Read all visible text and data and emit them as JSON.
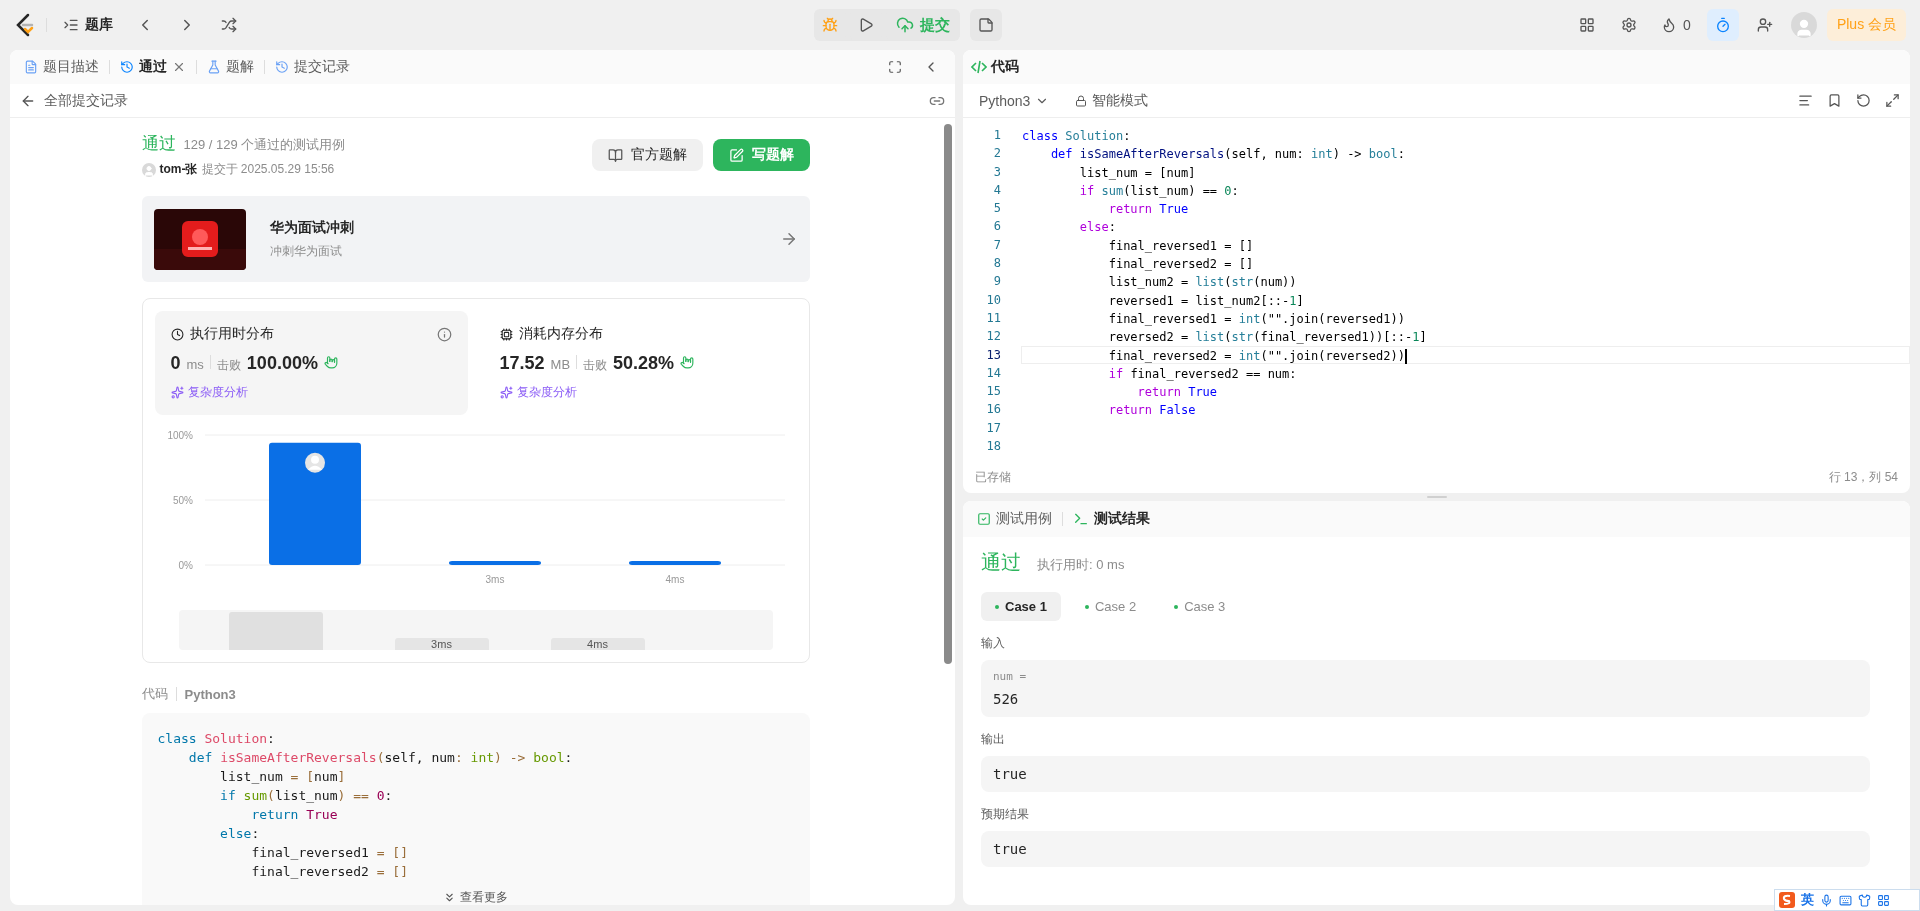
{
  "top_bar": {
    "problem_list": "题库",
    "submit": "提交",
    "streak": "0",
    "plus": "Plus 会员"
  },
  "left_panel": {
    "tabs": [
      {
        "label": "题目描述",
        "selected": false,
        "closable": false
      },
      {
        "label": "通过",
        "selected": true,
        "closable": true
      },
      {
        "label": "题解",
        "selected": false,
        "closable": false
      },
      {
        "label": "提交记录",
        "selected": false,
        "closable": false
      }
    ],
    "back_link": "全部提交记录",
    "result": {
      "status": "通过",
      "tests": "129 / 129 个通过的测试用例",
      "user": "tom-张",
      "submitted": "提交于 2025.05.29 15:56"
    },
    "buttons": [
      "官方题解",
      "写题解"
    ],
    "promo": {
      "title": "华为面试冲刺",
      "subtitle": "冲刺华为面试"
    },
    "stats": [
      {
        "title": "执行用时分布",
        "value": "0",
        "unit": "ms",
        "beats_label": "击败",
        "beats": "100.00%",
        "analysis": "复杂度分析",
        "selected": true
      },
      {
        "title": "消耗内存分布",
        "value": "17.52",
        "unit": "MB",
        "beats_label": "击败",
        "beats": "50.28%",
        "analysis": "复杂度分析",
        "selected": false
      }
    ],
    "chart_data": {
      "type": "bar",
      "categories": [
        null,
        "3ms",
        "4ms"
      ],
      "values": [
        94,
        3,
        3
      ],
      "ylim": [
        0,
        100
      ],
      "yticks": [
        {
          "value": 0,
          "label": "0%"
        },
        {
          "value": 50,
          "label": "50%"
        },
        {
          "value": 100,
          "label": "100%"
        }
      ]
    },
    "overview_labels": [
      "3ms",
      "4ms"
    ],
    "code": {
      "label": "代码",
      "language": "Python3",
      "more": "查看更多",
      "lines": [
        [
          {
            "text": "class ",
            "kind": "kw"
          },
          {
            "text": "Solution",
            "kind": "cls"
          },
          {
            "text": ":",
            "kind": "p"
          }
        ],
        [
          {
            "text": "    def ",
            "kind": "kw"
          },
          {
            "text": "isSameAfterReversals",
            "kind": "fn"
          },
          {
            "text": "(",
            "kind": "op"
          },
          {
            "text": "self, num",
            "kind": "p"
          },
          {
            "text": ": ",
            "kind": "op"
          },
          {
            "text": "int",
            "kind": "ty"
          },
          {
            "text": ") -> ",
            "kind": "op"
          },
          {
            "text": "bool",
            "kind": "ty"
          },
          {
            "text": ":",
            "kind": "p"
          }
        ],
        [
          {
            "text": "        list_num ",
            "kind": "p"
          },
          {
            "text": "= [",
            "kind": "op"
          },
          {
            "text": "num",
            "kind": "p"
          },
          {
            "text": "]",
            "kind": "op"
          }
        ],
        [
          {
            "text": "        if ",
            "kind": "ctl"
          },
          {
            "text": "sum",
            "kind": "bi"
          },
          {
            "text": "(",
            "kind": "op"
          },
          {
            "text": "list_num",
            "kind": "p"
          },
          {
            "text": ") == ",
            "kind": "op"
          },
          {
            "text": "0",
            "kind": "num"
          },
          {
            "text": ":",
            "kind": "p"
          }
        ],
        [
          {
            "text": "            return ",
            "kind": "ctl"
          },
          {
            "text": "True",
            "kind": "con"
          }
        ],
        [
          {
            "text": "        else",
            "kind": "ctl"
          },
          {
            "text": ":",
            "kind": "p"
          }
        ],
        [
          {
            "text": "            final_reversed1 ",
            "kind": "p"
          },
          {
            "text": "= []",
            "kind": "op"
          }
        ],
        [
          {
            "text": "            final_reversed2 ",
            "kind": "p"
          },
          {
            "text": "= []",
            "kind": "op"
          }
        ]
      ]
    }
  },
  "editor": {
    "title": "代码",
    "language": "Python3",
    "mode": "智能模式",
    "saved": "已存储",
    "cursor": "行 13，列 54",
    "lines": [
      {
        "no": "1",
        "current": false,
        "tokens": [
          {
            "text": "class ",
            "kind": "kw"
          },
          {
            "text": "Solution",
            "kind": "cls"
          },
          {
            "text": ":",
            "kind": "p"
          }
        ]
      },
      {
        "no": "2",
        "current": false,
        "tokens": [
          {
            "text": "    def ",
            "kind": "kw"
          },
          {
            "text": "isSameAfterReversals",
            "kind": "fn"
          },
          {
            "text": "(self, num: ",
            "kind": "p"
          },
          {
            "text": "int",
            "kind": "ty"
          },
          {
            "text": ") -> ",
            "kind": "p"
          },
          {
            "text": "bool",
            "kind": "ty"
          },
          {
            "text": ":",
            "kind": "p"
          }
        ]
      },
      {
        "no": "3",
        "current": false,
        "tokens": [
          {
            "text": "        list_num = [num]",
            "kind": "p"
          }
        ]
      },
      {
        "no": "4",
        "current": false,
        "tokens": [
          {
            "text": "        if ",
            "kind": "ctl"
          },
          {
            "text": "sum",
            "kind": "bi"
          },
          {
            "text": "(list_num) == ",
            "kind": "p"
          },
          {
            "text": "0",
            "kind": "num"
          },
          {
            "text": ":",
            "kind": "p"
          }
        ]
      },
      {
        "no": "5",
        "current": false,
        "tokens": [
          {
            "text": "            return ",
            "kind": "ctl"
          },
          {
            "text": "True",
            "kind": "con"
          }
        ]
      },
      {
        "no": "6",
        "current": false,
        "tokens": [
          {
            "text": "        else",
            "kind": "ctl"
          },
          {
            "text": ":",
            "kind": "p"
          }
        ]
      },
      {
        "no": "7",
        "current": false,
        "tokens": [
          {
            "text": "            final_reversed1 = []",
            "kind": "p"
          }
        ]
      },
      {
        "no": "8",
        "current": false,
        "tokens": [
          {
            "text": "            final_reversed2 = []",
            "kind": "p"
          }
        ]
      },
      {
        "no": "9",
        "current": false,
        "tokens": [
          {
            "text": "            list_num2 = ",
            "kind": "p"
          },
          {
            "text": "list",
            "kind": "bi"
          },
          {
            "text": "(",
            "kind": "p"
          },
          {
            "text": "str",
            "kind": "bi"
          },
          {
            "text": "(num))",
            "kind": "p"
          }
        ]
      },
      {
        "no": "10",
        "current": false,
        "tokens": [
          {
            "text": "            reversed1 = list_num2[::-",
            "kind": "p"
          },
          {
            "text": "1",
            "kind": "num"
          },
          {
            "text": "]",
            "kind": "p"
          }
        ]
      },
      {
        "no": "11",
        "current": false,
        "tokens": [
          {
            "text": "            final_reversed1 = ",
            "kind": "p"
          },
          {
            "text": "int",
            "kind": "bi"
          },
          {
            "text": "(\"\".join(reversed1))",
            "kind": "p"
          }
        ]
      },
      {
        "no": "12",
        "current": false,
        "tokens": [
          {
            "text": "            reversed2 = ",
            "kind": "p"
          },
          {
            "text": "list",
            "kind": "bi"
          },
          {
            "text": "(",
            "kind": "p"
          },
          {
            "text": "str",
            "kind": "bi"
          },
          {
            "text": "(final_reversed1))[::-",
            "kind": "p"
          },
          {
            "text": "1",
            "kind": "num"
          },
          {
            "text": "]",
            "kind": "p"
          }
        ]
      },
      {
        "no": "13",
        "current": true,
        "tokens": [
          {
            "text": "            final_reversed2 = ",
            "kind": "p"
          },
          {
            "text": "int",
            "kind": "bi"
          },
          {
            "text": "(\"\".join(reversed2))",
            "kind": "p"
          }
        ]
      },
      {
        "no": "14",
        "current": false,
        "tokens": [
          {
            "text": "            if ",
            "kind": "ctl"
          },
          {
            "text": "final_reversed2 == num:",
            "kind": "p"
          }
        ]
      },
      {
        "no": "15",
        "current": false,
        "tokens": [
          {
            "text": "                return ",
            "kind": "ctl"
          },
          {
            "text": "True",
            "kind": "con"
          }
        ]
      },
      {
        "no": "16",
        "current": false,
        "tokens": [
          {
            "text": "            return ",
            "kind": "ctl"
          },
          {
            "text": "False",
            "kind": "con"
          }
        ]
      },
      {
        "no": "17",
        "current": false
      },
      {
        "no": "18",
        "current": false
      }
    ]
  },
  "test_panel": {
    "tabs": [
      {
        "label": "测试用例",
        "selected": false
      },
      {
        "label": "测试结果",
        "selected": true
      }
    ],
    "status": "通过",
    "runtime": "执行用时: 0 ms",
    "cases": [
      {
        "label": "Case 1",
        "selected": true
      },
      {
        "label": "Case 2",
        "selected": false
      },
      {
        "label": "Case 3",
        "selected": false
      }
    ],
    "sections": [
      {
        "label": "输入",
        "var": "num =",
        "value": "526"
      },
      {
        "label": "输出",
        "value": "true"
      },
      {
        "label": "预期结果",
        "value": "true"
      }
    ]
  },
  "ime": {
    "mode": "英"
  }
}
